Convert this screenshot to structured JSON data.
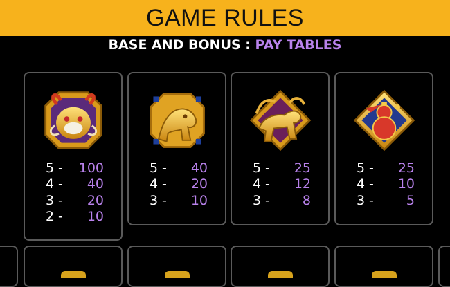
{
  "header": {
    "title": "GAME RULES"
  },
  "subtitle": {
    "prefix": "BASE AND BONUS :",
    "accent": "PAY TABLES"
  },
  "colors": {
    "header_bg": "#f7b21c",
    "accent": "#b982ec",
    "card_border": "#5a5a5a",
    "gold": "#f2c230"
  },
  "cards": [
    {
      "icon": "dragon-icon",
      "pays": [
        {
          "count": "5",
          "amount": "100"
        },
        {
          "count": "4",
          "amount": "40"
        },
        {
          "count": "3",
          "amount": "20"
        },
        {
          "count": "2",
          "amount": "10"
        }
      ]
    },
    {
      "icon": "tiger-icon",
      "pays": [
        {
          "count": "5",
          "amount": "40"
        },
        {
          "count": "4",
          "amount": "20"
        },
        {
          "count": "3",
          "amount": "10"
        }
      ]
    },
    {
      "icon": "ox-icon",
      "pays": [
        {
          "count": "5",
          "amount": "25"
        },
        {
          "count": "4",
          "amount": "12"
        },
        {
          "count": "3",
          "amount": "8"
        }
      ]
    },
    {
      "icon": "gourd-icon",
      "pays": [
        {
          "count": "5",
          "amount": "25"
        },
        {
          "count": "4",
          "amount": "10"
        },
        {
          "count": "3",
          "amount": "5"
        }
      ]
    }
  ]
}
